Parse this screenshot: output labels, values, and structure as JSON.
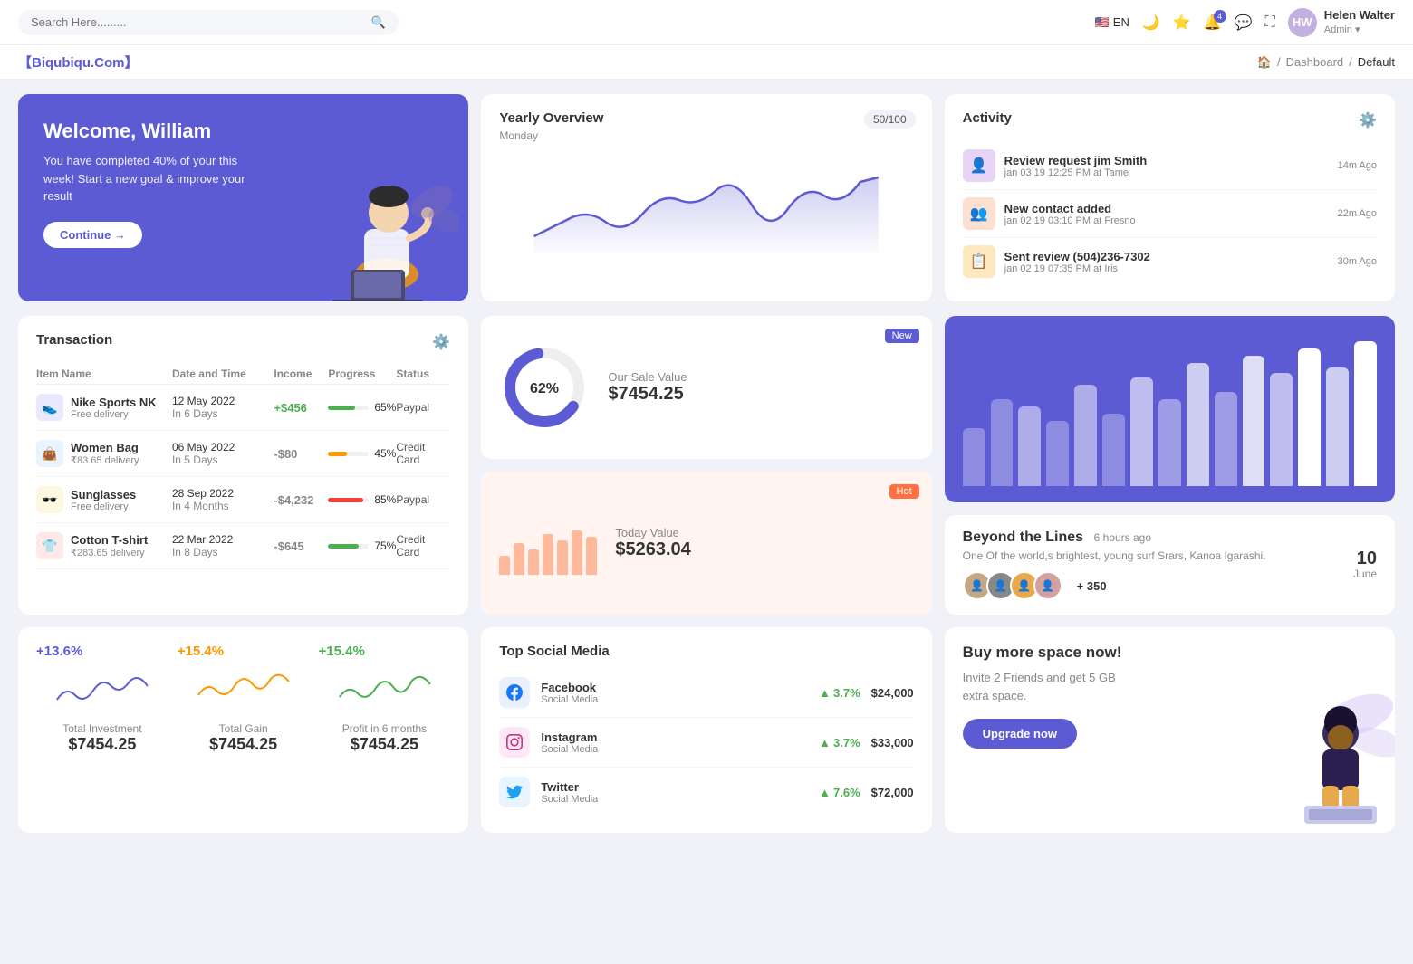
{
  "header": {
    "search_placeholder": "Search Here.........",
    "lang": "EN",
    "user_name": "Helen Walter",
    "user_role": "Admin",
    "notification_count": "4"
  },
  "breadcrumb": {
    "brand": "【Biqubiqu.Com】",
    "home": "Home",
    "dashboard": "Dashboard",
    "current": "Default"
  },
  "welcome": {
    "title": "Welcome, William",
    "subtitle": "You have completed 40% of your this week! Start a new goal & improve your result",
    "button": "Continue →"
  },
  "yearly_overview": {
    "title": "Yearly Overview",
    "subtitle": "Monday",
    "badge": "50/100"
  },
  "activity": {
    "title": "Activity",
    "items": [
      {
        "title": "Review request jim Smith",
        "detail": "jan 03 19 12:25 PM at Tame",
        "time": "14m Ago",
        "color": "#e8d5f5"
      },
      {
        "title": "New contact added",
        "detail": "jan 02 19 03:10 PM at Fresno",
        "time": "22m Ago",
        "color": "#fde0d0"
      },
      {
        "title": "Sent review (504)236-7302",
        "detail": "jan 02 19 07:35 PM at Iris",
        "time": "30m Ago",
        "color": "#fde8c0"
      }
    ]
  },
  "transaction": {
    "title": "Transaction",
    "columns": [
      "Item Name",
      "Date and Time",
      "Income",
      "Progress",
      "Status"
    ],
    "rows": [
      {
        "name": "Nike Sports NK",
        "sub": "Free delivery",
        "icon": "👟",
        "icon_bg": "#e8e8ff",
        "date": "12 May 2022",
        "days": "In 6 Days",
        "income": "+$456",
        "income_type": "pos",
        "progress": 65,
        "progress_color": "#4caf50",
        "status": "Paypal"
      },
      {
        "name": "Women Bag",
        "sub": "₹83.65 delivery",
        "icon": "👜",
        "icon_bg": "#e8f4ff",
        "date": "06 May 2022",
        "days": "In 5 Days",
        "income": "-$80",
        "income_type": "neg",
        "progress": 45,
        "progress_color": "#ff9800",
        "status": "Credit Card"
      },
      {
        "name": "Sunglasses",
        "sub": "Free delivery",
        "icon": "🕶️",
        "icon_bg": "#fff8e1",
        "date": "28 Sep 2022",
        "days": "In 4 Months",
        "income": "-$4,232",
        "income_type": "neg",
        "progress": 85,
        "progress_color": "#f44336",
        "status": "Paypal"
      },
      {
        "name": "Cotton T-shirt",
        "sub": "₹283.65 delivery",
        "icon": "👕",
        "icon_bg": "#ffe8e8",
        "date": "22 Mar 2022",
        "days": "In 8 Days",
        "income": "-$645",
        "income_type": "neg",
        "progress": 75,
        "progress_color": "#4caf50",
        "status": "Credit Card"
      }
    ]
  },
  "sale_value": {
    "badge": "New",
    "percent": "62%",
    "label": "Our Sale Value",
    "value": "$7454.25"
  },
  "today_value": {
    "badge": "Hot",
    "label": "Today Value",
    "value": "$5263.04",
    "bars": [
      30,
      50,
      40,
      65,
      55,
      70,
      60
    ]
  },
  "bar_chart": {
    "bars": [
      40,
      60,
      80,
      50,
      90,
      70,
      110,
      85,
      130,
      100,
      140,
      120,
      150,
      130,
      160
    ]
  },
  "beyond": {
    "title": "Beyond the Lines",
    "time_ago": "6 hours ago",
    "desc": "One Of the world,s brightest, young surf Srars, Kanoa Igarashi.",
    "plus_count": "+ 350",
    "date": "10",
    "month": "June",
    "avatar_colors": [
      "#c4a882",
      "#7c7c7c",
      "#e8a84c",
      "#d4a0a0"
    ]
  },
  "sparklines": [
    {
      "pct": "+13.6%",
      "color": "#5c5bd4",
      "label": "Total Investment",
      "value": "$7454.25"
    },
    {
      "pct": "+15.4%",
      "color": "#ff9800",
      "label": "Total Gain",
      "value": "$7454.25"
    },
    {
      "pct": "+15.4%",
      "color": "#4caf50",
      "label": "Profit in 6 months",
      "value": "$7454.25"
    }
  ],
  "social_media": {
    "title": "Top Social Media",
    "items": [
      {
        "name": "Facebook",
        "sub": "Social Media",
        "icon": "f",
        "icon_bg": "#e8f0fe",
        "icon_color": "#1877f2",
        "pct": "3.7%",
        "amount": "$24,000"
      },
      {
        "name": "Instagram",
        "sub": "Social Media",
        "icon": "◉",
        "icon_bg": "#fde8f5",
        "icon_color": "#c13584",
        "pct": "3.7%",
        "amount": "$33,000"
      },
      {
        "name": "Twitter",
        "sub": "Social Media",
        "icon": "🐦",
        "icon_bg": "#e8f5ff",
        "icon_color": "#1da1f2",
        "pct": "7.6%",
        "amount": "$72,000"
      }
    ]
  },
  "buy_space": {
    "title": "Buy more space now!",
    "desc": "Invite 2 Friends and get 5 GB extra space.",
    "button": "Upgrade now"
  }
}
